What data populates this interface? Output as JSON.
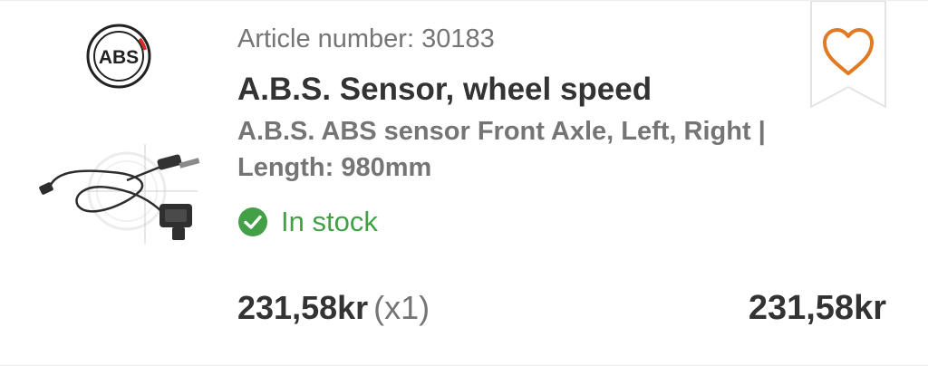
{
  "product": {
    "article_number": "Article number: 30183",
    "title": "A.B.S. Sensor, wheel speed",
    "description": "A.B.S. ABS sensor Front Axle, Left, Right | Length: 980mm",
    "brand_logo_text": "ABS",
    "stock_status": "In stock",
    "unit_price": "231,58kr",
    "quantity": "(x1)",
    "total_price": "231,58kr"
  },
  "icons": {
    "stock": "check-circle-icon",
    "favorite": "heart-outline-icon"
  },
  "colors": {
    "accent_orange": "#e07b24",
    "stock_green": "#43a047",
    "text_dark": "#333333",
    "text_muted": "#757575"
  }
}
